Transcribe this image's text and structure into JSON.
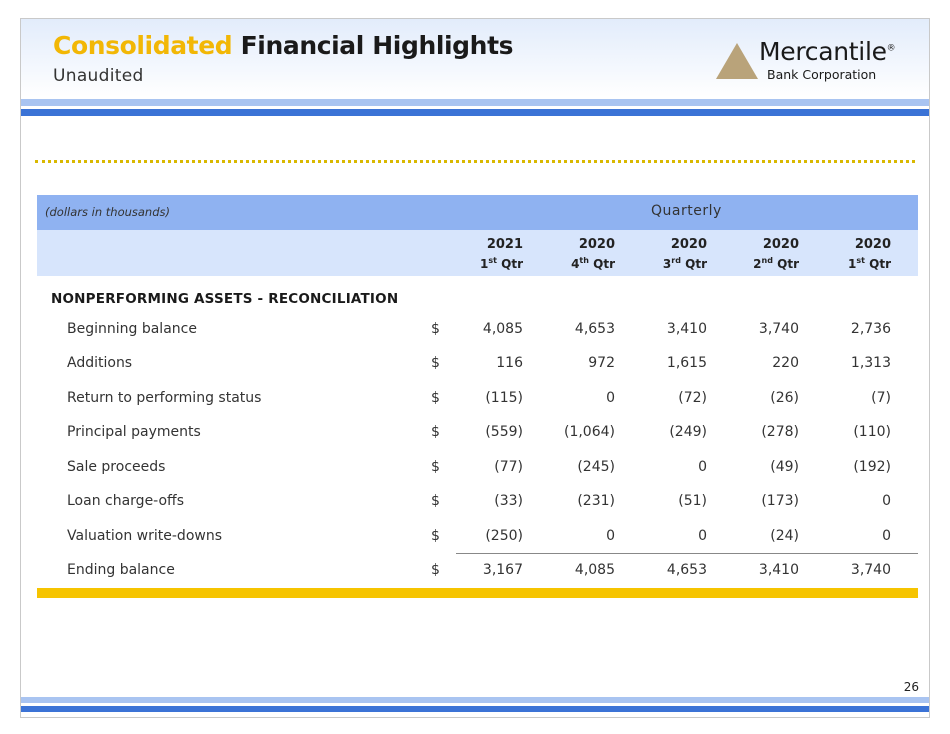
{
  "header": {
    "title_accent": "Consolidated",
    "title_main": "Financial Highlights",
    "subtitle": "Unaudited"
  },
  "logo": {
    "icon": "triangle-logo-icon",
    "name": "Mercantile",
    "mark": "®",
    "sub": "Bank Corporation"
  },
  "colors": {
    "accent_gold": "#f2b705",
    "band_dark": "#8fb2f1",
    "band_light": "#d7e5fc",
    "rule_blue": "#3b73d6",
    "gold_bar": "#f6c400"
  },
  "table": {
    "units": "(dollars in thousands)",
    "group_header": "Quarterly",
    "columns": [
      {
        "year": "2021",
        "q": "1",
        "sup": "st",
        "qtr": "Qtr"
      },
      {
        "year": "2020",
        "q": "4",
        "sup": "th",
        "qtr": "Qtr"
      },
      {
        "year": "2020",
        "q": "3",
        "sup": "rd",
        "qtr": "Qtr"
      },
      {
        "year": "2020",
        "q": "2",
        "sup": "nd",
        "qtr": "Qtr"
      },
      {
        "year": "2020",
        "q": "1",
        "sup": "st",
        "qtr": "Qtr"
      }
    ],
    "section_title": "NONPERFORMING ASSETS - RECONCILIATION",
    "currency": "$",
    "rows": [
      {
        "label": "Beginning balance",
        "values": [
          "4,085",
          "4,653",
          "3,410",
          "3,740",
          "2,736"
        ]
      },
      {
        "label": "Additions",
        "values": [
          "116",
          "972",
          "1,615",
          "220",
          "1,313"
        ]
      },
      {
        "label": "Return to performing status",
        "values": [
          "(115)",
          "0",
          "(72)",
          "(26)",
          "(7)"
        ]
      },
      {
        "label": "Principal payments",
        "values": [
          "(559)",
          "(1,064)",
          "(249)",
          "(278)",
          "(110)"
        ]
      },
      {
        "label": "Sale proceeds",
        "values": [
          "(77)",
          "(245)",
          "0",
          "(49)",
          "(192)"
        ]
      },
      {
        "label": "Loan charge-offs",
        "values": [
          "(33)",
          "(231)",
          "(51)",
          "(173)",
          "0"
        ]
      },
      {
        "label": "Valuation write-downs",
        "values": [
          "(250)",
          "0",
          "0",
          "(24)",
          "0"
        ]
      },
      {
        "label": "Ending balance",
        "values": [
          "3,167",
          "4,085",
          "4,653",
          "3,410",
          "3,740"
        ]
      }
    ]
  },
  "footer": {
    "page_number": "26"
  }
}
